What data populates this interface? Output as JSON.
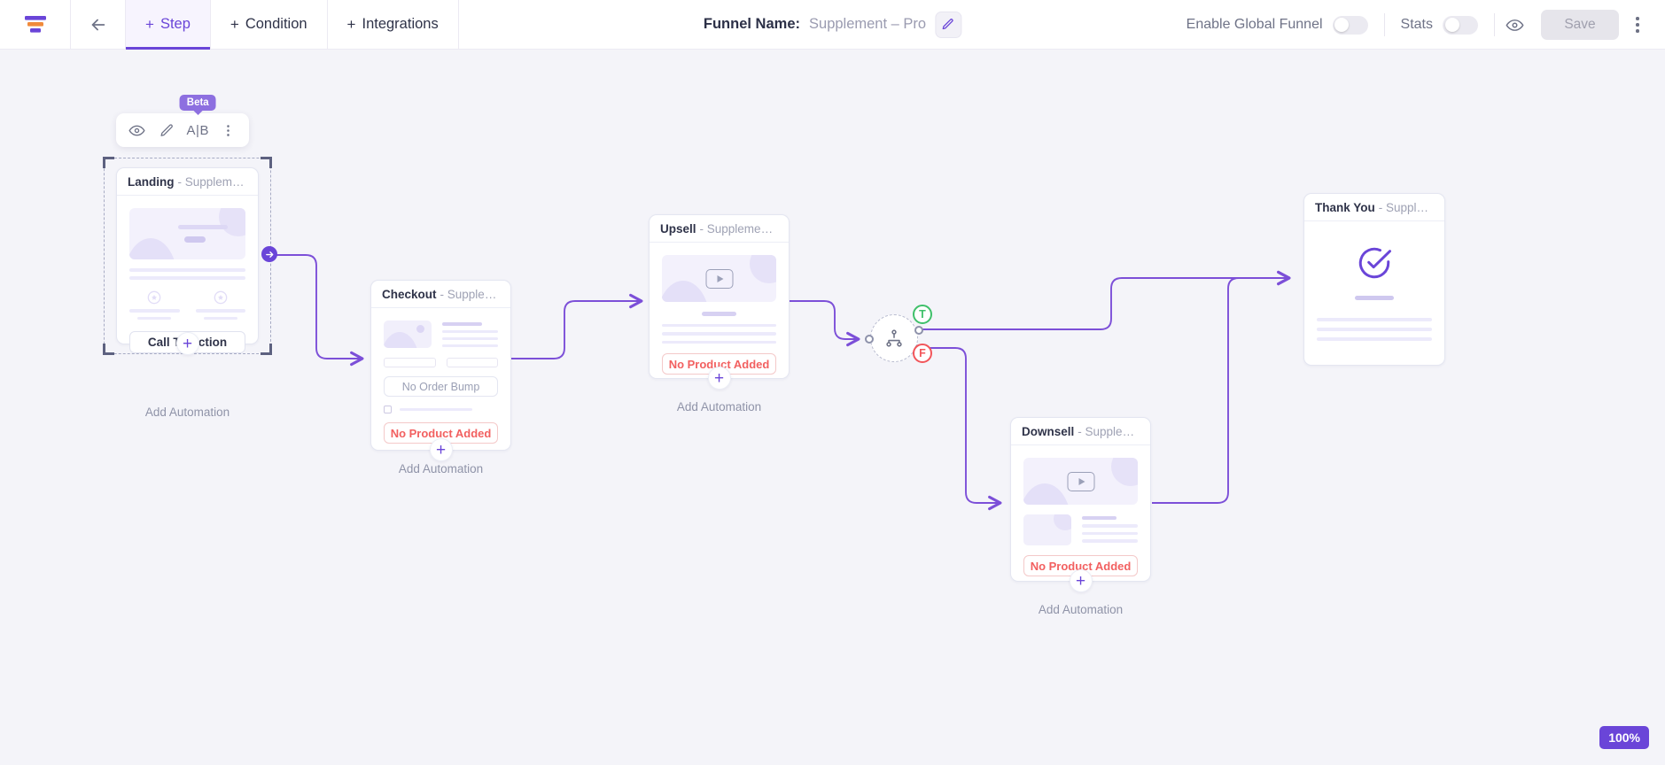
{
  "topbar": {
    "logo_icon": "funnel-logo-icon",
    "back_icon": "back-arrow-icon",
    "tabs": [
      {
        "label": "Step",
        "plus": "+",
        "active": true
      },
      {
        "label": "Condition",
        "plus": "+",
        "active": false
      },
      {
        "label": "Integrations",
        "plus": "+",
        "active": false
      }
    ],
    "funnel_label": "Funnel Name:",
    "funnel_value": "Supplement – Pro",
    "edit_icon": "pencil-edit-icon",
    "global_funnel_label": "Enable Global Funnel",
    "global_funnel_on": false,
    "stats_label": "Stats",
    "stats_on": false,
    "preview_icon": "eye-preview-icon",
    "save_label": "Save",
    "save_disabled": true,
    "more_icon": "kebab-menu-icon"
  },
  "node_toolbar": {
    "beta_badge": "Beta",
    "items": [
      {
        "name": "preview-icon",
        "label": ""
      },
      {
        "name": "edit-pencil-icon",
        "label": ""
      },
      {
        "name": "ab-test-icon",
        "label": "A|B"
      },
      {
        "name": "more-options-icon",
        "label": ""
      }
    ]
  },
  "nodes": [
    {
      "id": "landing",
      "title": "Landing",
      "subtitle": "- Supplement La...",
      "selected": true,
      "add_automation": "Add Automation",
      "cta_label": "Call To Action",
      "plus": "+"
    },
    {
      "id": "checkout",
      "title": "Checkout",
      "subtitle": "- Supplement C...",
      "selected": false,
      "add_automation": "Add Automation",
      "order_bump_label": "No Order Bump",
      "no_product_label": "No Product Added",
      "plus": "+"
    },
    {
      "id": "upsell",
      "title": "Upsell",
      "subtitle": "- Supplement U...",
      "selected": false,
      "add_automation": "Add Automation",
      "no_product_label": "No Product Added",
      "plus": "+"
    },
    {
      "id": "downsell",
      "title": "Downsell",
      "subtitle": "- Supplement D...",
      "selected": false,
      "add_automation": "Add Automation",
      "no_product_label": "No Product Added",
      "plus": "+"
    },
    {
      "id": "thankyou",
      "title": "Thank You",
      "subtitle": "- Supplement T...",
      "selected": false,
      "success_icon": "check-circle-icon"
    }
  ],
  "condition": {
    "icon": "branch-split-icon",
    "true_label": "T",
    "false_label": "F"
  },
  "zoom": {
    "level": "100%"
  },
  "colors": {
    "accent": "#6a45d8",
    "canvas": "#f4f4f9",
    "edge": "#7c4fd8",
    "danger": "#f26060",
    "success": "#3fc06a",
    "beta": "#8d6fe0"
  }
}
